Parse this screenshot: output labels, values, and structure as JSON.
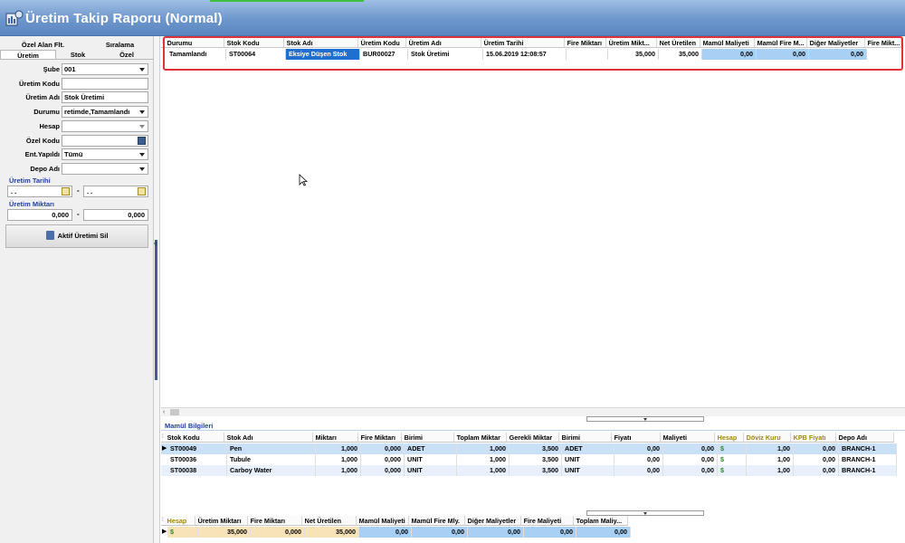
{
  "window": {
    "title": "Üretim Takip Raporu (Normal)"
  },
  "left": {
    "tabs_row1": [
      "Özel Alan Flt.",
      "Sıralama"
    ],
    "tabs_row2": [
      "Üretim",
      "Stok",
      "Özel"
    ],
    "fields": {
      "sube": {
        "label": "Şube",
        "value": "001"
      },
      "uretim_kodu": {
        "label": "Üretim Kodu",
        "value": ""
      },
      "uretim_adi": {
        "label": "Üretim Adı",
        "value": "Stok Üretimi"
      },
      "durumu": {
        "label": "Durumu",
        "value": "retimde,Tamamlandı"
      },
      "hesap": {
        "label": "Hesap",
        "value": ""
      },
      "ozel_kodu": {
        "label": "Özel Kodu",
        "value": ""
      },
      "ent_yapildi": {
        "label": "Ent.Yapıldı",
        "value": "Tümü"
      },
      "depo_adi": {
        "label": "Depo Adı",
        "value": ""
      }
    },
    "uretim_tarihi": {
      "label": "Üretim Tarihi",
      "from": ". .",
      "to": ". ."
    },
    "uretim_miktari": {
      "label": "Üretim Miktarı",
      "from": "0,000",
      "to": "0,000"
    },
    "range_separator": "-",
    "delete_button": "Aktif Üretimi Sil"
  },
  "main_grid": {
    "columns": [
      "Durumu",
      "Stok Kodu",
      "Stok Adı",
      "Üretim Kodu",
      "Üretim Adı",
      "Üretim Tarihi",
      "Fire Miktarı",
      "Üretim Mikt...",
      "Net Üretilen",
      "Mamül Maliyeti",
      "Mamül Fire M...",
      "Diğer Maliyetler",
      "Fire Mikt..."
    ],
    "rows": [
      [
        "Tamamlandı",
        "ST00064",
        "Eksiye Düşen Stok",
        "BUR00027",
        "Stok Üretimi",
        "15.06.2019 12:08:57",
        "",
        "35,000",
        "35,000",
        "0,00",
        "0,00",
        "0,00",
        ""
      ]
    ]
  },
  "mamul": {
    "title": "Mamül Bilgileri",
    "columns": [
      "Stok Kodu",
      "Stok Adı",
      "Miktarı",
      "Fire Miktarı",
      "Birimi",
      "Toplam Miktar",
      "Gerekli Miktar",
      "Birimi",
      "Fiyatı",
      "Maliyeti",
      "Hesap",
      "Döviz Kuru",
      "KPB Fiyatı",
      "Depo Adı"
    ],
    "rows": [
      [
        "ST00049",
        "Pen",
        "1,000",
        "0,000",
        "ADET",
        "1,000",
        "3,500",
        "ADET",
        "0,00",
        "0,00",
        "$",
        "1,00",
        "0,00",
        "BRANCH-1"
      ],
      [
        "ST00036",
        "Tubule",
        "1,000",
        "0,000",
        "UNIT",
        "1,000",
        "3,500",
        "UNIT",
        "0,00",
        "0,00",
        "$",
        "1,00",
        "0,00",
        "BRANCH-1"
      ],
      [
        "ST00038",
        "Carboy Water",
        "1,000",
        "0,000",
        "UNIT",
        "1,000",
        "3,500",
        "UNIT",
        "0,00",
        "0,00",
        "$",
        "1,00",
        "0,00",
        "BRANCH-1"
      ]
    ]
  },
  "footer": {
    "columns": [
      "Hesap",
      "Üretim Miktarı",
      "Fire Miktarı",
      "Net Üretilen",
      "Mamül Maliyeti",
      "Mamül Fire Mly.",
      "Diğer Maliyetler",
      "Fire Maliyeti",
      "Toplam Maliy..."
    ],
    "row": [
      "$",
      "35,000",
      "0,000",
      "35,000",
      "0,00",
      "0,00",
      "0,00",
      "0,00",
      "0,00"
    ]
  },
  "colors": {
    "titlebar": "#6d96cc",
    "selection": "#1f6fd0",
    "highlight": "#a8d0f5",
    "redbox": "#e0303a"
  }
}
